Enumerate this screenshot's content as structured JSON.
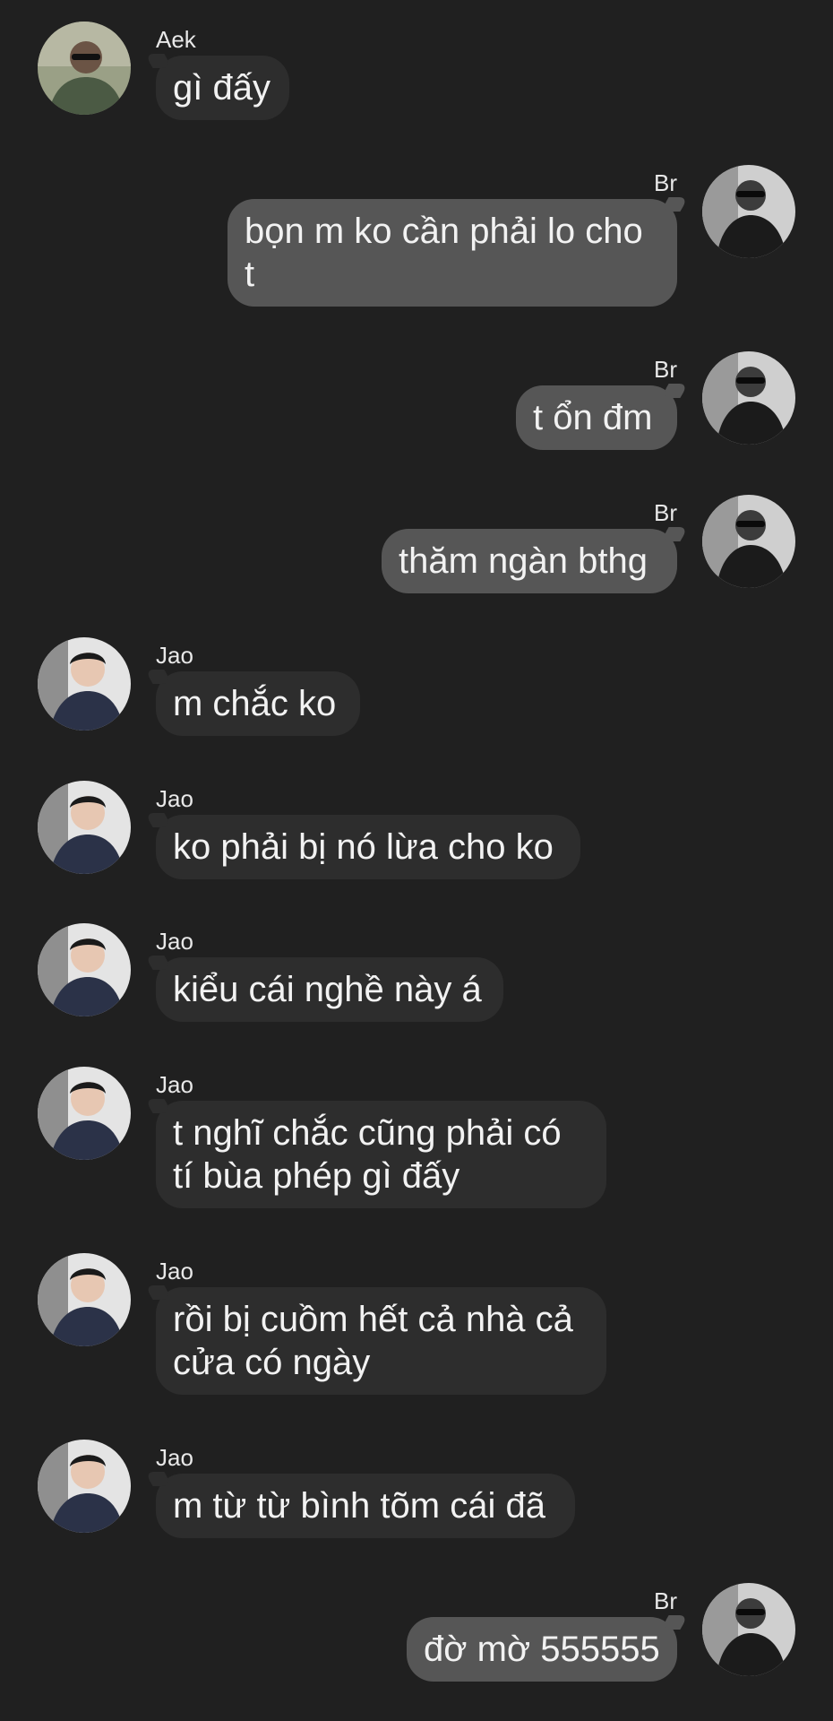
{
  "messages": [
    {
      "sender": "Aek",
      "text": "gì đấy",
      "side": "left",
      "avatar": "aek-avatar"
    },
    {
      "sender": "Br",
      "text": "bọn m ko cần phải lo cho t",
      "side": "right",
      "avatar": "br-avatar"
    },
    {
      "sender": "Br",
      "text": "t ổn đm",
      "side": "right",
      "avatar": "br-avatar"
    },
    {
      "sender": "Br",
      "text": "thăm ngàn bthg",
      "side": "right",
      "avatar": "br-avatar"
    },
    {
      "sender": "Jao",
      "text": "m chắc ko",
      "side": "left",
      "avatar": "jao-avatar"
    },
    {
      "sender": "Jao",
      "text": "ko phải bị nó lừa cho ko",
      "side": "left",
      "avatar": "jao-avatar"
    },
    {
      "sender": "Jao",
      "text": "kiểu cái nghề này á",
      "side": "left",
      "avatar": "jao-avatar"
    },
    {
      "sender": "Jao",
      "text": "t nghĩ chắc cũng phải có tí bùa phép gì đấy",
      "side": "left",
      "avatar": "jao-avatar"
    },
    {
      "sender": "Jao",
      "text": "rồi bị cuồm hết cả nhà cả cửa có ngày",
      "side": "left",
      "avatar": "jao-avatar"
    },
    {
      "sender": "Jao",
      "text": "m từ từ bình tõm cái đã",
      "side": "left",
      "avatar": "jao-avatar"
    },
    {
      "sender": "Br",
      "text": "đờ mờ 555555",
      "side": "right",
      "avatar": "br-avatar"
    }
  ],
  "colors": {
    "background": "#202020",
    "incoming_bubble": "#2d2d2d",
    "outgoing_bubble": "#565656",
    "text": "#f2f2f2"
  }
}
